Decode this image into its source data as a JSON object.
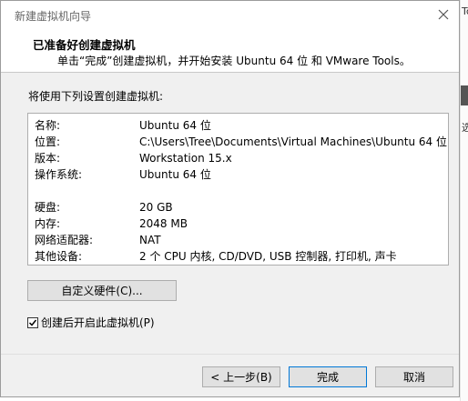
{
  "window": {
    "title": "新建虚拟机向导"
  },
  "header": {
    "title": "已准备好创建虚拟机",
    "subtitle": "单击“完成”创建虚拟机，并开始安装 Ubuntu 64 位 和 VMware Tools。"
  },
  "description": "将使用下列设置创建虚拟机:",
  "settings": [
    {
      "label": "名称:",
      "value": "Ubuntu 64 位"
    },
    {
      "label": "位置:",
      "value": "C:\\Users\\Tree\\Documents\\Virtual Machines\\Ubuntu 64 位"
    },
    {
      "label": "版本:",
      "value": "Workstation 15.x"
    },
    {
      "label": "操作系统:",
      "value": "Ubuntu 64 位"
    },
    {
      "label": "硬盘:",
      "value": "20 GB"
    },
    {
      "label": "内存:",
      "value": "2048 MB"
    },
    {
      "label": "网络适配器:",
      "value": "NAT"
    },
    {
      "label": "其他设备:",
      "value": "2 个 CPU 内核, CD/DVD, USB 控制器, 打印机, 声卡"
    }
  ],
  "buttons": {
    "customize": "自定义硬件(C)...",
    "back": "< 上一步(B)",
    "finish": "完成",
    "cancel": "取消"
  },
  "power_on": {
    "label": "创建后开启此虚拟机(P)",
    "checked": true
  },
  "background": {
    "frag_top": "Tc",
    "frag_mid": "选"
  }
}
